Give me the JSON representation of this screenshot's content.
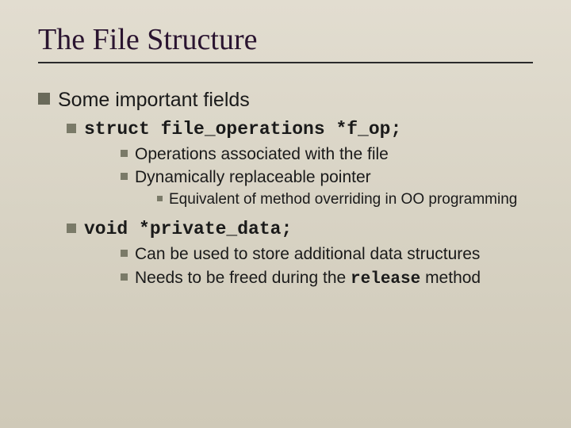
{
  "title": "The File Structure",
  "l1": "Some important fields",
  "field1": {
    "decl": "struct file_operations *f_op;",
    "sub1": "Operations associated with the file",
    "sub2": "Dynamically replaceable pointer",
    "sub2a": "Equivalent of method overriding in OO programming"
  },
  "field2": {
    "decl": "void *private_data;",
    "sub1": "Can be used to store additional data structures",
    "sub2_pre": "Needs to be freed during the ",
    "sub2_code": "release",
    "sub2_post": " method"
  }
}
